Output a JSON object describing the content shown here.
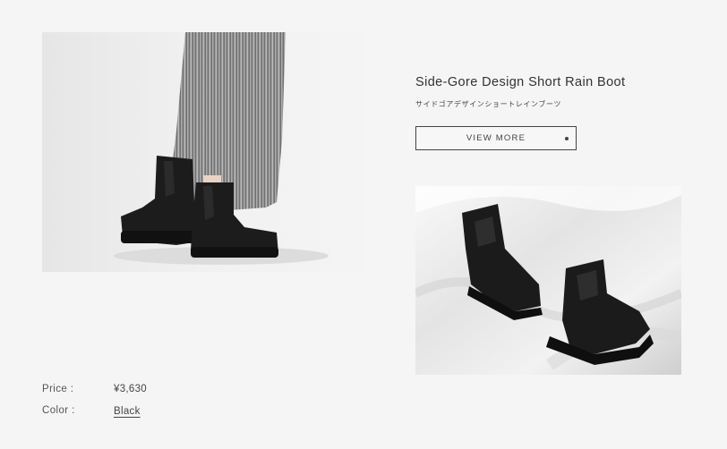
{
  "product": {
    "title": "Side-Gore Design Short Rain Boot",
    "subtitle": "サイドゴアデザインショートレインブーツ",
    "view_more_label": "VIEW MORE"
  },
  "specs": {
    "price_label": "Price :",
    "price_value": "¥3,630",
    "color_label": "Color :",
    "color_value": "Black"
  },
  "colors": {
    "background": "#f5f5f5",
    "text": "#333333",
    "boot": "#1c1c1c"
  }
}
